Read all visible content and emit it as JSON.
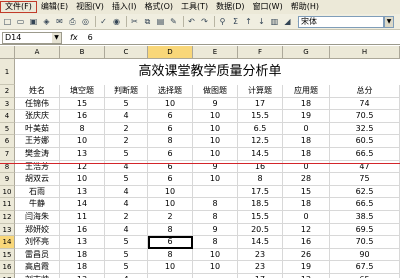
{
  "menu": [
    "文件(F)",
    "编辑(E)",
    "视图(V)",
    "插入(I)",
    "格式(O)",
    "工具(T)",
    "数据(D)",
    "窗口(W)",
    "帮助(H)"
  ],
  "toolbar": {
    "font_name": "宋体"
  },
  "formula_bar": {
    "cell_ref": "D14",
    "fx": "fx",
    "value": "6"
  },
  "columns": [
    "A",
    "B",
    "C",
    "D",
    "E",
    "F",
    "G",
    "H"
  ],
  "rows": [
    "1",
    "2",
    "3",
    "4",
    "5",
    "6",
    "7",
    "8",
    "9",
    "10",
    "11",
    "12",
    "13",
    "14",
    "15",
    "16",
    "17"
  ],
  "title": "高效课堂教学质量分析单",
  "headers": [
    "姓名",
    "填空题",
    "判断题",
    "选择题",
    "做图题",
    "计算题",
    "应用题",
    "总分"
  ],
  "data": [
    [
      "任锦伟",
      "15",
      "5",
      "10",
      "9",
      "17",
      "18",
      "74"
    ],
    [
      "张庆庆",
      "16",
      "4",
      "6",
      "10",
      "15.5",
      "19",
      "70.5"
    ],
    [
      "叶美茹",
      "8",
      "2",
      "6",
      "10",
      "6.5",
      "0",
      "32.5"
    ],
    [
      "王芳娜",
      "10",
      "2",
      "8",
      "10",
      "12.5",
      "18",
      "60.5"
    ],
    [
      "樊金涛",
      "13",
      "5",
      "6",
      "10",
      "14.5",
      "18",
      "66.5"
    ],
    [
      "王浩芳",
      "12",
      "4",
      "6",
      "9",
      "16",
      "0",
      "47"
    ],
    [
      "胡双云",
      "10",
      "5",
      "6",
      "10",
      "8",
      "28",
      "75"
    ],
    [
      "石雨",
      "13",
      "4",
      "10",
      "",
      "17.5",
      "15",
      "62.5"
    ],
    [
      "牛静",
      "14",
      "4",
      "10",
      "8",
      "18.5",
      "18",
      "66.5"
    ],
    [
      "闫海朱",
      "11",
      "2",
      "2",
      "8",
      "15.5",
      "0",
      "38.5"
    ],
    [
      "郑妍姣",
      "16",
      "4",
      "8",
      "9",
      "20.5",
      "12",
      "69.5"
    ],
    [
      "刘怀亮",
      "13",
      "5",
      "6",
      "8",
      "14.5",
      "16",
      "70.5"
    ],
    [
      "雷昌员",
      "18",
      "5",
      "8",
      "10",
      "23",
      "26",
      "90"
    ],
    [
      "高启霞",
      "18",
      "5",
      "10",
      "10",
      "23",
      "19",
      "67.5"
    ],
    [
      "刘志帅",
      "13",
      "4",
      "",
      "",
      "17",
      "12",
      "65"
    ]
  ],
  "colors": {
    "accent": "#f9d779",
    "menu_bg": "#ece9d8",
    "red_line": "#d3252a"
  }
}
